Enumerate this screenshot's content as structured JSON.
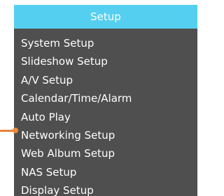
{
  "colors": {
    "header_background": "#55cff0",
    "menu_background": "#4f4f4f",
    "text": "#ffffff",
    "selection_indicator": "#f08b3a"
  },
  "menu": {
    "title": "Setup",
    "items": [
      {
        "label": "System Setup"
      },
      {
        "label": "Slideshow Setup"
      },
      {
        "label": "A/V Setup"
      },
      {
        "label": "Calendar/Time/Alarm"
      },
      {
        "label": "Auto Play"
      },
      {
        "label": "Networking Setup",
        "selected": true
      },
      {
        "label": "Web Album Setup"
      },
      {
        "label": "NAS Setup"
      },
      {
        "label": "Display Setup"
      }
    ]
  },
  "indicator": {
    "icon": "selection-pointer-icon"
  }
}
